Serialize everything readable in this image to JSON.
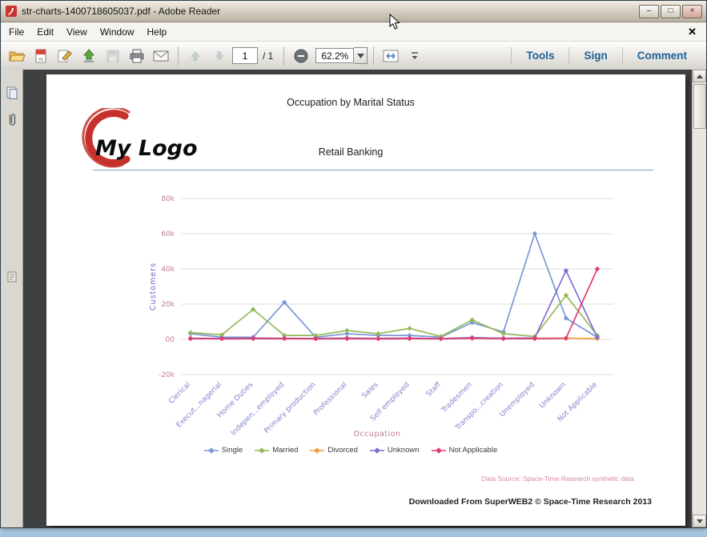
{
  "window": {
    "title": "str-charts-1400718605037.pdf - Adobe Reader",
    "controls": [
      {
        "name": "minimize",
        "glyph": "–"
      },
      {
        "name": "maximize",
        "glyph": "□"
      },
      {
        "name": "close",
        "glyph": "×"
      }
    ]
  },
  "menubar": {
    "items": [
      {
        "label": "File"
      },
      {
        "label": "Edit"
      },
      {
        "label": "View"
      },
      {
        "label": "Window"
      },
      {
        "label": "Help"
      }
    ],
    "close_label": "✕"
  },
  "toolbar": {
    "page_current": "1",
    "page_total": "/ 1",
    "zoom": "62.2%",
    "right_buttons": [
      {
        "label": "Tools"
      },
      {
        "label": "Sign"
      },
      {
        "label": "Comment"
      }
    ]
  },
  "page": {
    "logo_text": "My Logo",
    "footer": "Downloaded From SuperWEB2 © Space-Time Research 2013"
  },
  "chart_data": {
    "type": "line",
    "title": "Occupation by Marital Status",
    "subtitle": "Retail Banking",
    "xlabel": "Occupation",
    "ylabel": "Customers",
    "ylim": [
      -20000,
      80000
    ],
    "yticks": [
      80000,
      60000,
      40000,
      20000,
      0,
      -20000
    ],
    "ytick_labels": [
      "80k",
      "60k",
      "40k",
      "20k",
      "00",
      "-20k"
    ],
    "grid": true,
    "legend_position": "bottom",
    "source_note": "Data Source: Space-Time Research synthetic data",
    "axis_colors": {
      "ytick": "#c8798f",
      "xtick": "#8084cc",
      "ylabel": "#6f65c8",
      "xlabel": "#c07d8d",
      "gridline": "#dcdcdc"
    },
    "categories": [
      "Clerical",
      "Execut...nagerial",
      "Home Duties",
      "Indepen...employed",
      "Primary production",
      "Professional",
      "Sales",
      "Self employed",
      "Staff",
      "Tradesmen",
      "Transpo...creation",
      "Unemployed",
      "Unknown",
      "Not Applicable"
    ],
    "series": [
      {
        "name": "Single",
        "color": "#7b97d8",
        "values": [
          3200,
          1200,
          1200,
          21000,
          1200,
          3200,
          2200,
          2200,
          1200,
          9500,
          4200,
          60000,
          12000,
          1200
        ]
      },
      {
        "name": "Married",
        "color": "#94ba5a",
        "values": [
          3800,
          2600,
          17000,
          2200,
          2200,
          5000,
          3200,
          6200,
          1600,
          11000,
          3200,
          1600,
          25000,
          2200
        ]
      },
      {
        "name": "Divorced",
        "color": "#f0a13c",
        "values": [
          500,
          400,
          600,
          500,
          400,
          600,
          500,
          600,
          400,
          900,
          500,
          600,
          700,
          400
        ]
      },
      {
        "name": "Unknown",
        "color": "#7f6ed2",
        "values": [
          600,
          500,
          700,
          600,
          500,
          700,
          500,
          700,
          400,
          1000,
          600,
          800,
          39000,
          1100
        ]
      },
      {
        "name": "Not Applicable",
        "color": "#e23b6e",
        "values": [
          400,
          300,
          400,
          400,
          300,
          400,
          300,
          400,
          300,
          600,
          400,
          400,
          600,
          40000
        ]
      }
    ]
  }
}
